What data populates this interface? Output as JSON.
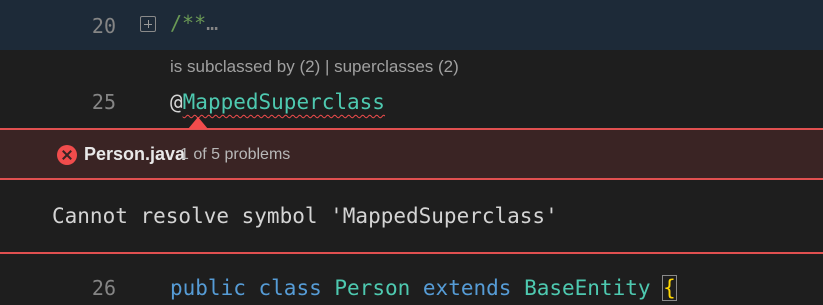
{
  "editor": {
    "lines": [
      {
        "number": "20",
        "fold_icon": "expand-fold-icon",
        "comment": "/**",
        "ellipsis": "…"
      },
      {
        "number": "25",
        "at": "@",
        "annotation": "MappedSuperclass"
      },
      {
        "number": "26",
        "tokens": {
          "kw1": "public",
          "kw2": "class",
          "class_name": "Person",
          "kw3": "extends",
          "base": "BaseEntity",
          "brace": "{"
        }
      }
    ],
    "codelens": "is subclassed by (2) | superclasses (2)"
  },
  "problem": {
    "icon": "error-icon",
    "file": "Person.java",
    "count": "1 of 5 problems",
    "message": "Cannot resolve symbol 'MappedSuperclass'",
    "color": "#f14c4c"
  },
  "colors": {
    "background": "#1e1e1e",
    "comment": "#6a9955",
    "keyword": "#569cd6",
    "type": "#4ec9b0",
    "error": "#f14c4c"
  }
}
